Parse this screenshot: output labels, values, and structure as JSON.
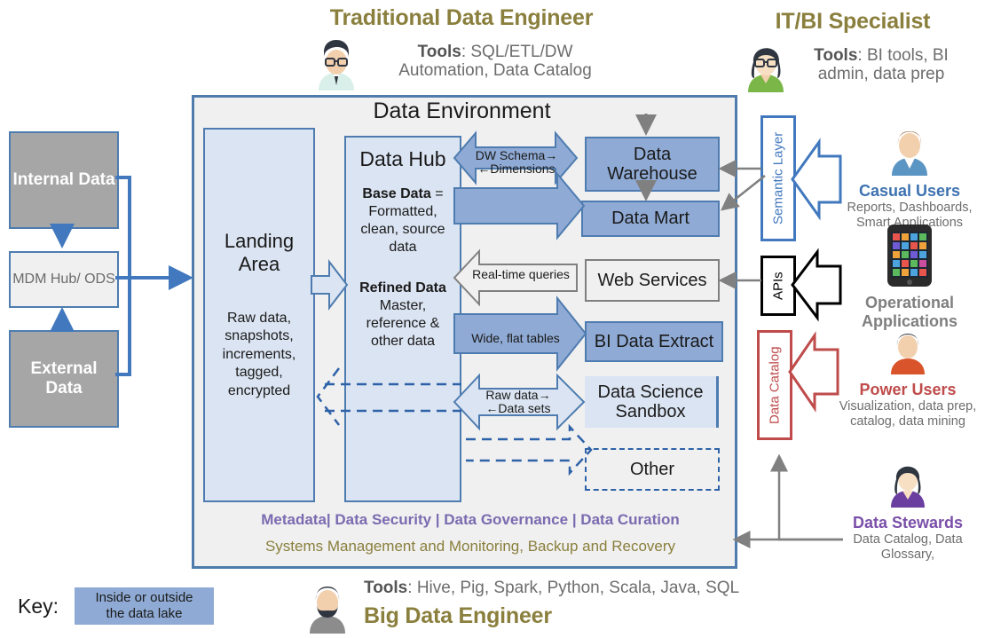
{
  "personas_top": {
    "traditional": {
      "title": "Traditional Data Engineer",
      "tools_label": "Tools",
      "tools_line1": ": SQL/ETL/DW",
      "tools_line2": "Automation, Data Catalog",
      "icon": "person-glasses-icon"
    },
    "itbi": {
      "title": "IT/BI Specialist",
      "tools_label": "Tools",
      "tools_line1": ": BI tools, BI",
      "tools_line2": "admin, data prep",
      "icon": "person-woman-glasses-icon"
    }
  },
  "sources": {
    "internal": "Internal Data",
    "mdm": "MDM Hub/ ODS",
    "external": "External Data"
  },
  "environment": {
    "title": "Data Environment",
    "landing": {
      "title_line1": "Landing",
      "title_line2": "Area",
      "body": "Raw data, snapshots, increments, tagged, encrypted"
    },
    "hub": {
      "title": "Data Hub",
      "base_label": "Base Data",
      "base_rest": " =",
      "base_body": "Formatted, clean, source data",
      "refined_label": "Refined Data",
      "refined_body": "Master, reference & other data"
    },
    "targets": {
      "data_warehouse": "Data Warehouse",
      "data_mart": "Data Mart",
      "web_services": "Web Services",
      "bi_extract": "BI Data Extract",
      "sandbox": "Data Science Sandbox",
      "other": "Other"
    },
    "flow_labels": {
      "dw_schema": "DW Schema→",
      "dimensions": "←Dimensions",
      "realtime": "Real-time queries",
      "wide_flat": "Wide, flat tables",
      "raw_data": "Raw data→",
      "data_sets": "←Data sets"
    },
    "governance_line1": "Metadata| Data Security | Data Governance | Data Curation",
    "governance_line2": "Systems Management and Monitoring, Backup and  Recovery"
  },
  "side_layers": {
    "semantic": "Semantic Layer",
    "apis": "APIs",
    "catalog": "Data Catalog"
  },
  "consumers": [
    {
      "name": "Casual Users",
      "desc_line1": "Reports, Dashboards,",
      "desc_line2": "Smart Applications",
      "color": "#3d72b0",
      "icon": "person-blue-shirt-icon"
    },
    {
      "name_line1": "Operational",
      "name_line2": "Applications",
      "color": "#7f7f7f",
      "icon": "smartphone-icon"
    },
    {
      "name": "Power Users",
      "desc_line1": "Visualization, data prep,",
      "desc_line2": "catalog, data mining",
      "color": "#bf4b4b",
      "icon": "person-orange-shirt-icon"
    },
    {
      "name": "Data Stewards",
      "desc_line1": "Data Catalog, Data",
      "desc_line2": "Glossary,",
      "color": "#7a4fa8",
      "icon": "person-purple-shirt-icon"
    }
  ],
  "key": {
    "label": "Key:",
    "box_line1": "Inside or outside",
    "box_line2": "the data lake"
  },
  "persona_bottom": {
    "tools_label": "Tools",
    "tools_rest": ": Hive, Pig, Spark, Python, Scala, Java, SQL",
    "title": "Big Data Engineer",
    "icon": "person-beard-icon"
  },
  "colors": {
    "accent_blue": "#4e7cb0",
    "box_blue": "#8faad4",
    "light_blue": "#dbe4f2",
    "olive": "#8a7f3d",
    "purple": "#7a6bb0",
    "red": "#bf4b4b"
  }
}
